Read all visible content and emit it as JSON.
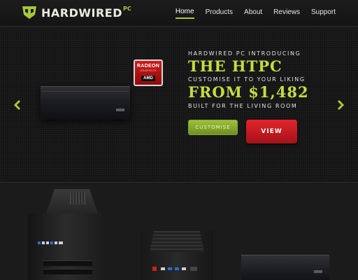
{
  "header": {
    "logo_text": "HARDWIRED",
    "logo_sup": "PC",
    "nav": [
      {
        "label": "Home",
        "active": true
      },
      {
        "label": "Products",
        "active": false
      },
      {
        "label": "About",
        "active": false
      },
      {
        "label": "Reviews",
        "active": false
      },
      {
        "label": "Support",
        "active": false
      }
    ]
  },
  "hero": {
    "line1": "HARDWIRED PC INTRODUCING",
    "line2": "THE HTPC",
    "line3": "CUSTOMISE IT TO YOUR LIKING",
    "line4": "FROM $1,482",
    "line5": "BUILT FOR THE LIVING ROOM",
    "customise_label": "CUSTOMISE",
    "view_label": "VIEW",
    "badge": {
      "title": "RADEON",
      "subtitle": "GRAPHICS",
      "brand": "AMD"
    },
    "prev_icon": "chevron-left-icon",
    "next_icon": "chevron-right-icon"
  },
  "colors": {
    "accent_green": "#a6c83a",
    "headline_green": "#c4de40",
    "view_red": "#d41e25",
    "background": "#141414"
  }
}
